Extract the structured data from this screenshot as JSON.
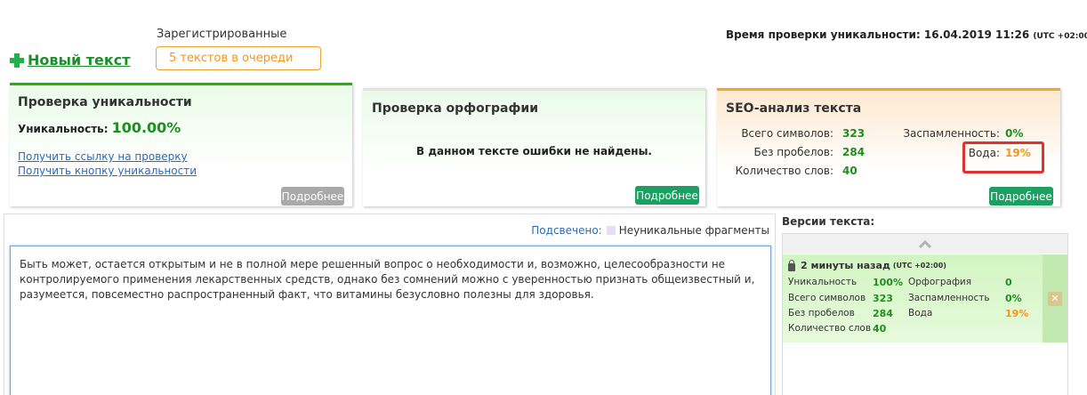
{
  "header": {
    "new_text_label": "Новый текст",
    "registered_label": "Зарегистрированные",
    "queue_badge": "5 текстов в очереди",
    "check_time_label": "Время проверки уникальности: 16.04.2019 11:26",
    "check_time_tz": "(UTC +02:00)"
  },
  "uniqueness_panel": {
    "title": "Проверка уникальности",
    "uniqueness_label": "Уникальность:",
    "uniqueness_value": "100.00%",
    "link_check": "Получить ссылку на проверку",
    "link_button": "Получить кнопку уникальности",
    "more_label": "Подробнее"
  },
  "spelling_panel": {
    "title": "Проверка орфографии",
    "message": "В данном тексте ошибки не найдены.",
    "more_label": "Подробнее"
  },
  "seo_panel": {
    "title": "SEO-анализ текста",
    "chars_label": "Всего символов:",
    "chars_value": "323",
    "no_spaces_label": "Без пробелов:",
    "no_spaces_value": "284",
    "words_label": "Количество слов:",
    "words_value": "40",
    "spam_label": "Заспамленность:",
    "spam_value": "0%",
    "water_label": "Вода:",
    "water_value": "19%",
    "more_label": "Подробнее"
  },
  "editor": {
    "legend_label": "Подсвечено:",
    "legend_text": "Неуникальные фрагменты",
    "text": "Быть может, остается открытым и не в полной мере решенный вопрос о необходимости и, возможно, целесообразности не контролируемого применения лекарственных средств, однако без сомнений можно с уверенностью признать общеизвестный и, разумеется, повсеместно распространенный факт, что витамины безусловно полезны для здоровья."
  },
  "versions": {
    "title": "Версии текста:",
    "card": {
      "time": "2 минуты назад",
      "tz": "(UTC +02:00)",
      "uniq_label": "Уникальность",
      "uniq_value": "100%",
      "chars_label": "Всего символов",
      "chars_value": "323",
      "no_spaces_label": "Без пробелов",
      "no_spaces_value": "284",
      "words_label": "Количество слов",
      "words_value": "40",
      "spelling_label": "Орфография",
      "spelling_value": "0",
      "spam_label": "Заспамленность",
      "spam_value": "0%",
      "water_label": "Вода",
      "water_value": "19%"
    }
  },
  "colors": {
    "accent_green": "#22b400",
    "accent_orange": "#f5a623",
    "highlight_red": "#e03030"
  }
}
